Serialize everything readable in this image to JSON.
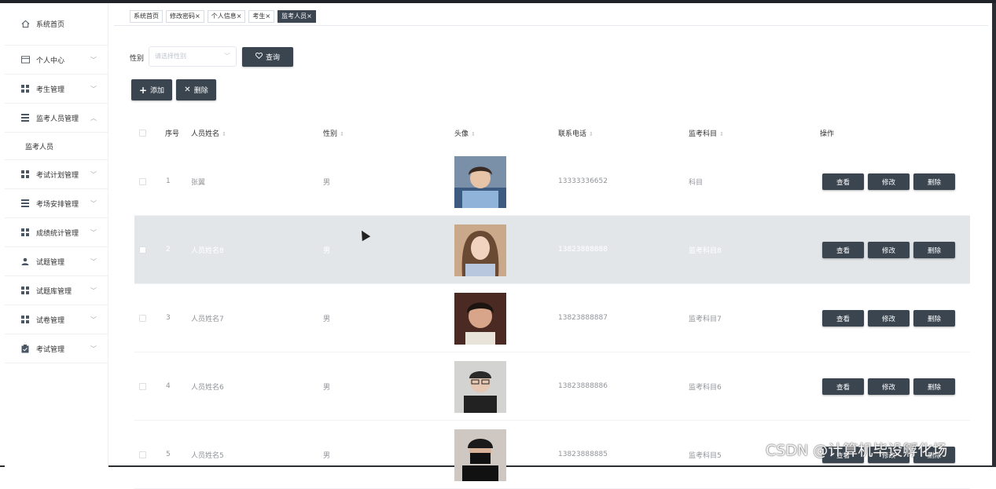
{
  "sidebar": {
    "items": [
      {
        "label": "系统首页",
        "icon": "home-icon",
        "expandable": false
      },
      {
        "label": "个人中心",
        "icon": "card-icon",
        "expandable": true
      },
      {
        "label": "考生管理",
        "icon": "grid-icon",
        "expandable": true
      },
      {
        "label": "监考人员管理",
        "icon": "list-icon",
        "expandable": true,
        "expanded": true
      },
      {
        "label": "考试计划管理",
        "icon": "grid-icon",
        "expandable": true
      },
      {
        "label": "考场安排管理",
        "icon": "list-icon",
        "expandable": true
      },
      {
        "label": "成绩统计管理",
        "icon": "grid-icon",
        "expandable": true
      },
      {
        "label": "试题管理",
        "icon": "user-icon",
        "expandable": true
      },
      {
        "label": "试题库管理",
        "icon": "grid-icon",
        "expandable": true
      },
      {
        "label": "试卷管理",
        "icon": "grid-icon",
        "expandable": true
      },
      {
        "label": "考试管理",
        "icon": "clipboard-icon",
        "expandable": true
      }
    ],
    "subitem": "监考人员"
  },
  "tabs": [
    {
      "label": "系统首页",
      "close": ""
    },
    {
      "label": "修改密码",
      "close": "×"
    },
    {
      "label": "个人信息",
      "close": "×"
    },
    {
      "label": "考生",
      "close": "×"
    },
    {
      "label": "监考人员",
      "close": "×",
      "active": true
    }
  ],
  "search": {
    "label": "性别",
    "placeholder": "请选择性别",
    "query_button": "查询"
  },
  "toolbar": {
    "add_label": "添加",
    "delete_label": "删除"
  },
  "table": {
    "headers": [
      "序号",
      "人员姓名",
      "性别",
      "头像",
      "联系电话",
      "监考科目",
      "操作"
    ],
    "actions": [
      "查看",
      "修改",
      "删除"
    ],
    "rows": [
      {
        "no": "1",
        "name": "张翼",
        "gender": "男",
        "phone": "13333336652",
        "subject": "科目"
      },
      {
        "no": "2",
        "name": "人员姓名8",
        "gender": "男",
        "phone": "13823888888",
        "subject": "监考科目8"
      },
      {
        "no": "3",
        "name": "人员姓名7",
        "gender": "男",
        "phone": "13823888887",
        "subject": "监考科目7"
      },
      {
        "no": "4",
        "name": "人员姓名6",
        "gender": "男",
        "phone": "13823888886",
        "subject": "监考科目6"
      },
      {
        "no": "5",
        "name": "人员姓名5",
        "gender": "男",
        "phone": "13823888885",
        "subject": "监考科目5"
      }
    ]
  },
  "watermark": "CSDN @计算机毕设孵化场"
}
